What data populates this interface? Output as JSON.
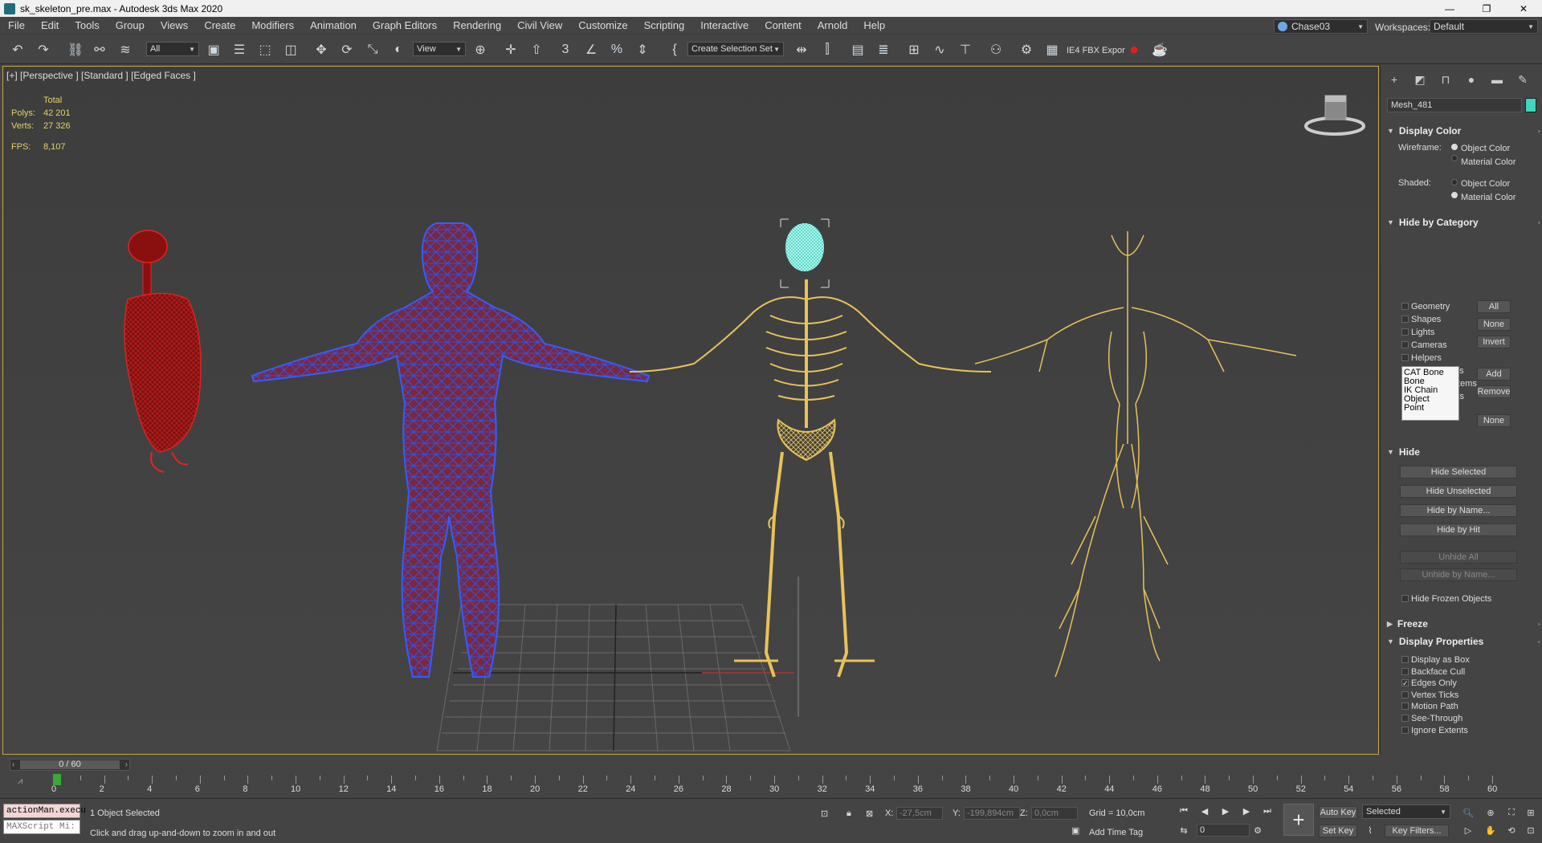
{
  "window": {
    "title": "sk_skeleton_pre.max - Autodesk 3ds Max 2020",
    "minimize": "—",
    "restore": "❐",
    "close": "✕"
  },
  "menu": [
    "File",
    "Edit",
    "Tools",
    "Group",
    "Views",
    "Create",
    "Modifiers",
    "Animation",
    "Graph Editors",
    "Rendering",
    "Civil View",
    "Customize",
    "Scripting",
    "Interactive",
    "Content",
    "Arnold",
    "Help"
  ],
  "user": {
    "name": "Chase03",
    "workspaces_label": "Workspaces:",
    "workspace": "Default"
  },
  "toolbar": {
    "filter": "All",
    "refcoord": "View",
    "selection_set": "Create Selection Set",
    "fbx_label": "IE4 FBX Expor"
  },
  "viewport": {
    "label": "[+] [Perspective ] [Standard ] [Edged Faces ]",
    "stats": {
      "header": "Total",
      "polys_label": "Polys:",
      "polys": "42 201",
      "verts_label": "Verts:",
      "verts": "27 326",
      "fps_label": "FPS:",
      "fps": "8,107"
    }
  },
  "panel": {
    "object_name": "Mesh_481",
    "object_color": "#3fd6c0",
    "display_color": {
      "title": "Display Color",
      "wireframe_label": "Wireframe:",
      "shaded_label": "Shaded:",
      "object_color": "Object Color",
      "material_color": "Material Color",
      "wireframe_selected": "Object Color",
      "shaded_selected": "Material Color"
    },
    "hide_by_category": {
      "title": "Hide by Category",
      "items": [
        {
          "label": "Geometry",
          "checked": false
        },
        {
          "label": "Shapes",
          "checked": false
        },
        {
          "label": "Lights",
          "checked": false
        },
        {
          "label": "Cameras",
          "checked": false
        },
        {
          "label": "Helpers",
          "checked": false
        },
        {
          "label": "Space Warps",
          "checked": false
        },
        {
          "label": "Particle Systems",
          "checked": false
        },
        {
          "label": "Bone Objects",
          "checked": true
        }
      ],
      "all": "All",
      "none": "None",
      "invert": "Invert",
      "list": [
        "CAT Bone",
        "Bone",
        "IK Chain Object",
        "Point"
      ],
      "add": "Add",
      "remove": "Remove",
      "none2": "None"
    },
    "hide": {
      "title": "Hide",
      "hide_selected": "Hide Selected",
      "hide_unselected": "Hide Unselected",
      "hide_by_name": "Hide by Name...",
      "hide_by_hit": "Hide by Hit",
      "unhide_all": "Unhide All",
      "unhide_by_name": "Unhide by Name...",
      "hide_frozen": "Hide Frozen Objects"
    },
    "freeze": {
      "title": "Freeze"
    },
    "display_properties": {
      "title": "Display Properties",
      "items": [
        {
          "label": "Display as Box",
          "checked": false
        },
        {
          "label": "Backface Cull",
          "checked": false
        },
        {
          "label": "Edges Only",
          "checked": true
        },
        {
          "label": "Vertex Ticks",
          "checked": false
        },
        {
          "label": "Motion Path",
          "checked": false
        },
        {
          "label": "See-Through",
          "checked": false
        },
        {
          "label": "Ignore Extents",
          "checked": false
        }
      ]
    }
  },
  "timeline": {
    "frame": "0 / 60",
    "ticks": [
      "0",
      "2",
      "4",
      "6",
      "8",
      "10",
      "12",
      "14",
      "16",
      "18",
      "20",
      "22",
      "24",
      "26",
      "28",
      "30",
      "32",
      "34",
      "36",
      "38",
      "40",
      "42",
      "44",
      "46",
      "48",
      "50",
      "52",
      "54",
      "56",
      "58",
      "60"
    ]
  },
  "status": {
    "maxscript1": "actionMan.execu",
    "maxscript2": "MAXScript Mi:",
    "selected": "1 Object Selected",
    "prompt": "Click and drag up-and-down to zoom in and out",
    "x_label": "X:",
    "x": "-27,5cm",
    "y_label": "Y:",
    "y": "-199,894cm",
    "z_label": "Z:",
    "z": "0,0cm",
    "grid": "Grid = 10,0cm",
    "add_time_tag": "Add Time Tag",
    "auto_key": "Auto Key",
    "set_key": "Set Key",
    "selected_mode": "Selected",
    "key_filters": "Key Filters...",
    "frame_input": "0"
  }
}
